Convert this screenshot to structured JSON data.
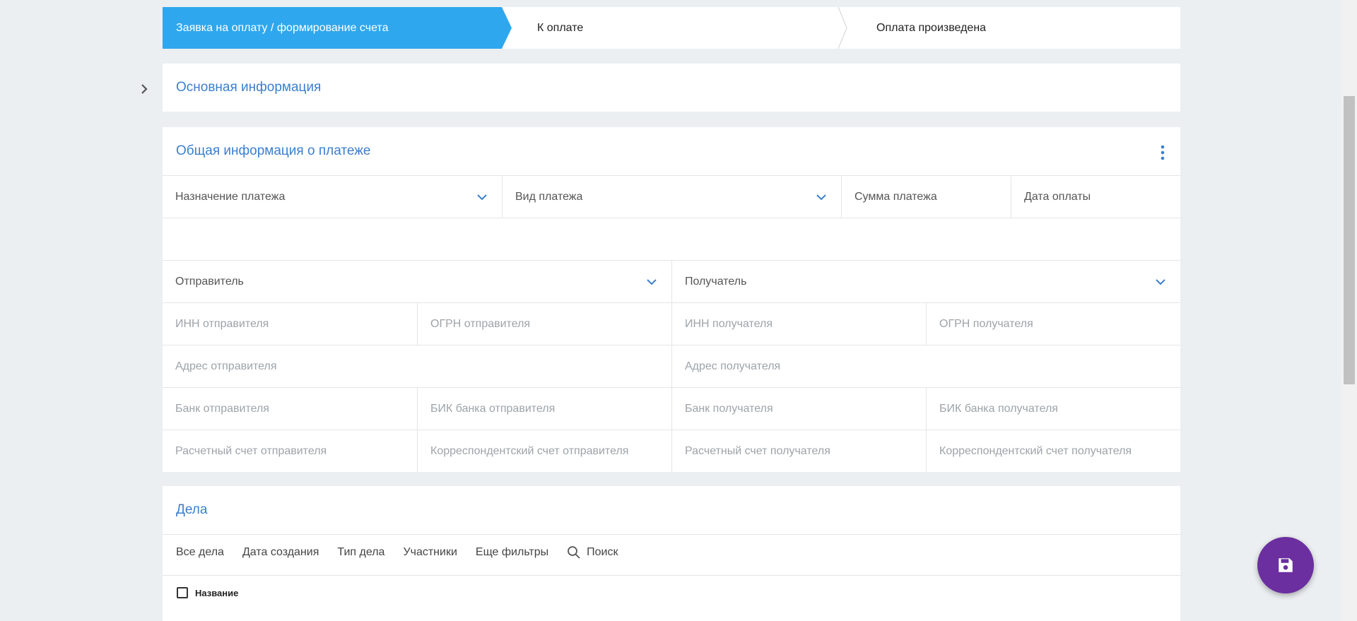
{
  "stepper": {
    "steps": [
      {
        "label": "Заявка на оплату / формирование счета",
        "active": true
      },
      {
        "label": "К оплате",
        "active": false
      },
      {
        "label": "Оплата произведена",
        "active": false
      }
    ]
  },
  "basic_info": {
    "title": "Основная информация"
  },
  "payment_info": {
    "title": "Общая информация о платеже",
    "fields_row1": [
      "Назначение платежа",
      "Вид платежа",
      "Сумма платежа",
      "Дата оплаты"
    ],
    "sender_label": "Отправитель",
    "receiver_label": "Получатель",
    "rows": [
      [
        "ИНН отправителя",
        "ОГРН отправителя",
        "ИНН получателя",
        "ОГРН получателя"
      ],
      [
        "Адрес отправителя",
        "Адрес получателя"
      ],
      [
        "Банк отправителя",
        "БИК банка отправителя",
        "Банк получателя",
        "БИК банка получателя"
      ],
      [
        "Расчетный счет отправителя",
        "Корреспондентский счет отправителя",
        "Расчетный счет получателя",
        "Корреспондентский счет получателя"
      ]
    ]
  },
  "cases": {
    "title": "Дела",
    "filters": [
      "Все дела",
      "Дата создания",
      "Тип дела",
      "Участники",
      "Еще фильтры"
    ],
    "search_label": "Поиск",
    "column_name": "Название"
  },
  "colors": {
    "accent": "#2ea7ee",
    "title": "#3b7fce",
    "fab": "#6b2fa0"
  },
  "icons": {
    "expand": "chevron-right-icon",
    "dropdown": "chevron-down-icon",
    "menu": "kebab-icon",
    "search": "search-icon",
    "save": "floppy-disk-icon"
  }
}
